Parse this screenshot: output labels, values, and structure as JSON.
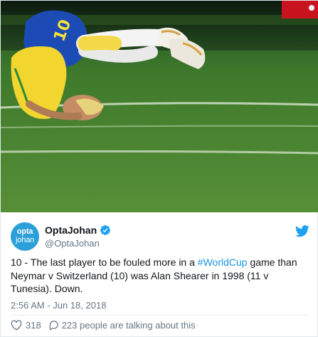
{
  "tweet": {
    "display_name": "OptaJohan",
    "handle": "@OptaJohan",
    "avatar": {
      "line1": "opta",
      "line2": "johan",
      "color": "#2a9fd8"
    },
    "text_before": "10 - The last player to be fouled more in a ",
    "hashtag": "#WorldCup",
    "text_after": " game than Neymar v Switzerland (10) was Alan Shearer in 1998 (11 v Tunesia). Down.",
    "timestamp": "2:56 AM - Jun 18, 2018",
    "likes": "318",
    "talking": "223 people are talking about this",
    "icons": [
      "verified-icon",
      "twitter-bird-icon",
      "heart-icon",
      "speech-bubble-icon"
    ],
    "colors": {
      "accent": "#1b95e0",
      "muted": "#657786",
      "text": "#14171a"
    }
  }
}
